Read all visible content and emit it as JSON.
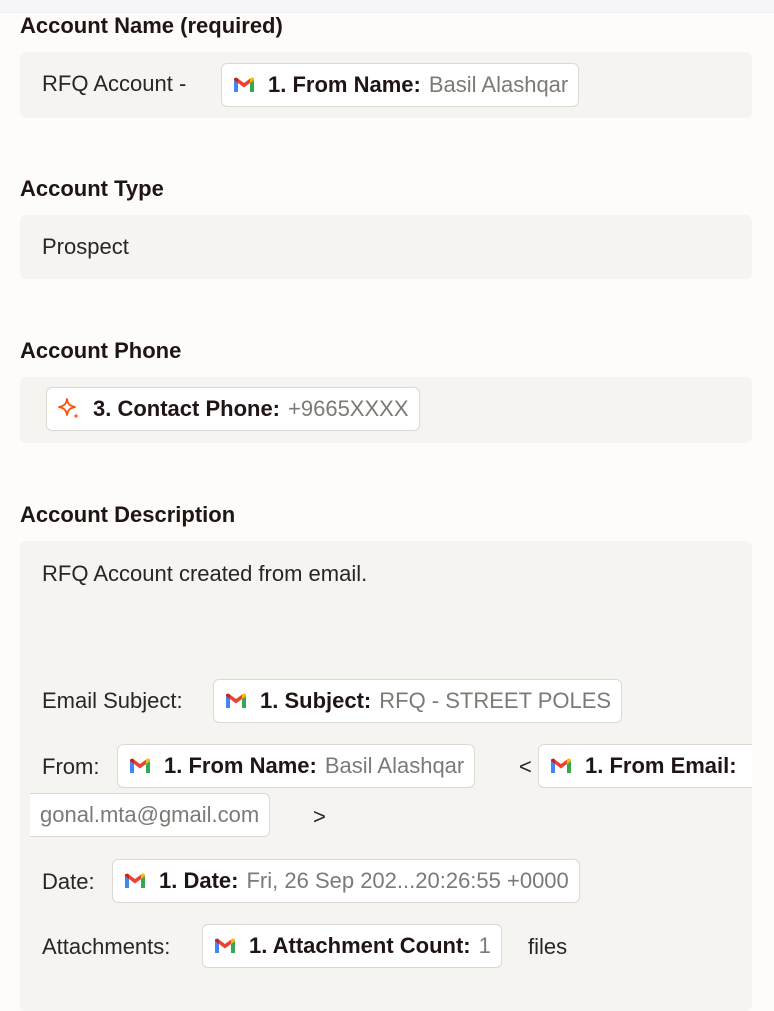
{
  "account_name": {
    "label": "Account Name (required)",
    "prefix": "RFQ Account -",
    "token": {
      "key": "1. From Name:",
      "value": "Basil Alashqar",
      "icon": "gmail-icon"
    }
  },
  "account_type": {
    "label": "Account Type",
    "value": "Prospect"
  },
  "account_phone": {
    "label": "Account Phone",
    "token": {
      "key": "3. Contact Phone:",
      "value": "+9665XXXX",
      "icon": "sparkle-ai-icon"
    }
  },
  "account_description": {
    "label": "Account Description",
    "intro": "RFQ Account created from email.",
    "subject_label": "Email Subject:",
    "subject_token": {
      "key": "1. Subject:",
      "value": "RFQ - STREET POLES",
      "icon": "gmail-icon"
    },
    "from_label": "From:",
    "from_name_token": {
      "key": "1. From Name:",
      "value": "Basil Alashqar",
      "icon": "gmail-icon"
    },
    "lt": "<",
    "from_email_token": {
      "key": "1. From Email:",
      "value": "gonal.mta@gmail.com",
      "icon": "gmail-icon"
    },
    "gt": ">",
    "date_label": "Date:",
    "date_token": {
      "key": "1. Date:",
      "value": "Fri, 26 Sep 202...20:26:55 +0000",
      "icon": "gmail-icon"
    },
    "attachments_label": "Attachments:",
    "attachments_token": {
      "key": "1. Attachment Count:",
      "value": "1",
      "icon": "gmail-icon"
    },
    "attachments_suffix": "files"
  },
  "colors": {
    "page_bg": "#fdfcf8",
    "field_bg": "#f5f4f1",
    "token_border": "#dcd9d3",
    "token_value": "#7d7a75",
    "ai_orange": "#ff4f00"
  }
}
